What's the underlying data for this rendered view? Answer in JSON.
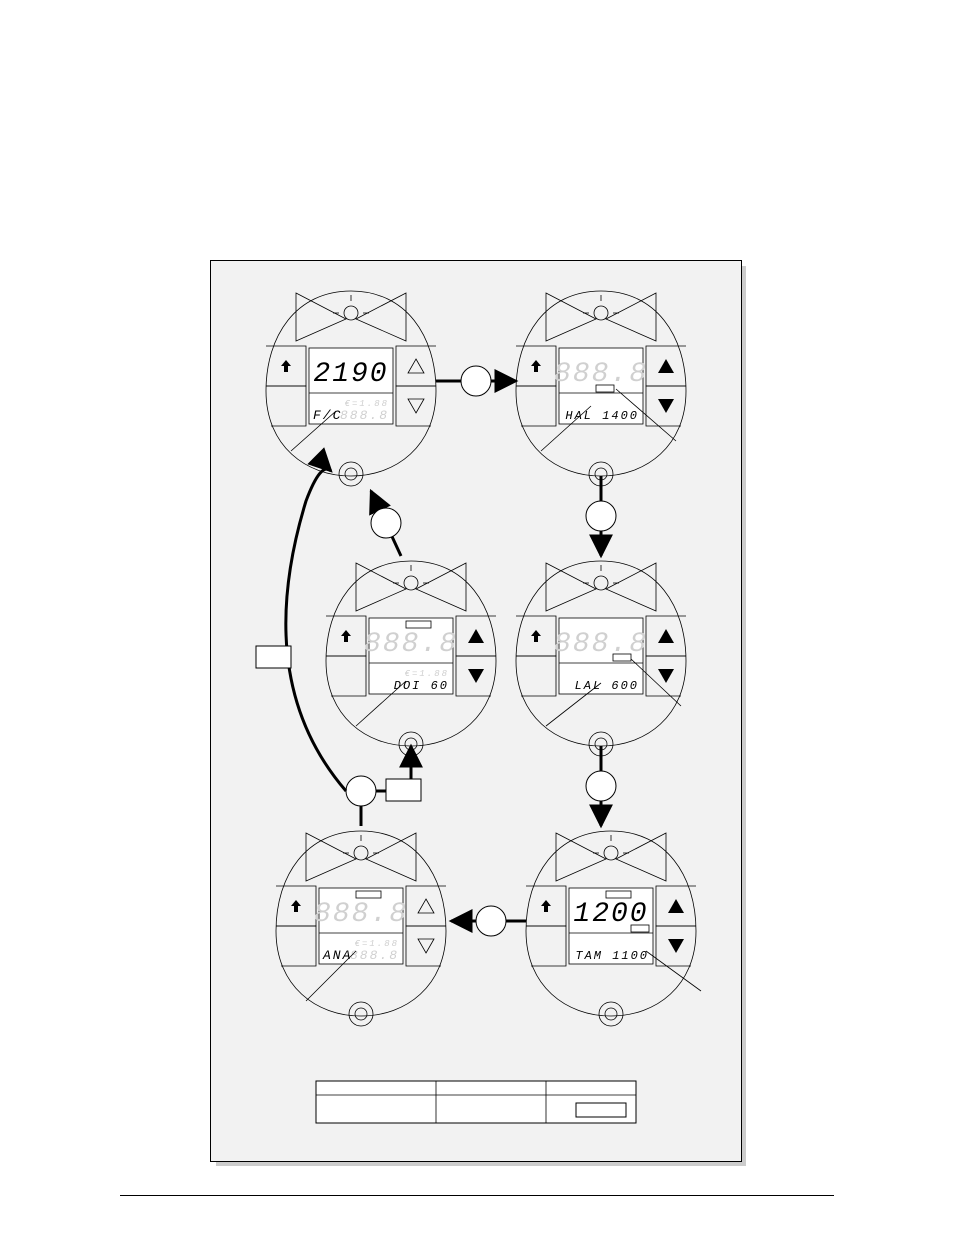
{
  "devices": {
    "d1": {
      "main": "2190",
      "sub": "F/C",
      "dimMain": false,
      "upFilled": false,
      "downFilled": false,
      "triangles": "hollow"
    },
    "d2": {
      "main": "888.8",
      "sub": "HAL 1400",
      "dimMain": true,
      "triangles": "solid"
    },
    "d3": {
      "main": "888.8",
      "sub": "DOI   60",
      "dimMain": true,
      "triangles": "solid"
    },
    "d4": {
      "main": "888.8",
      "sub": "LAL  600",
      "dimMain": true,
      "triangles": "solid"
    },
    "d5": {
      "main": "888.8",
      "sub": "ANA",
      "dimMain": true,
      "triangles": "hollow"
    },
    "d6": {
      "main": "1200",
      "sub": "TAM 1100",
      "dimMain": false,
      "triangles": "solid"
    }
  },
  "arrows": {
    "a1": {
      "label": ""
    },
    "a2": {
      "label": ""
    },
    "a3": {
      "label": ""
    },
    "a4": {
      "label": ""
    }
  },
  "branch": {
    "yes": "",
    "no": ""
  },
  "legend": {
    "c1": "",
    "c2": "",
    "c3": ""
  },
  "subDim": "888.8",
  "epsilon": "€=1.88"
}
